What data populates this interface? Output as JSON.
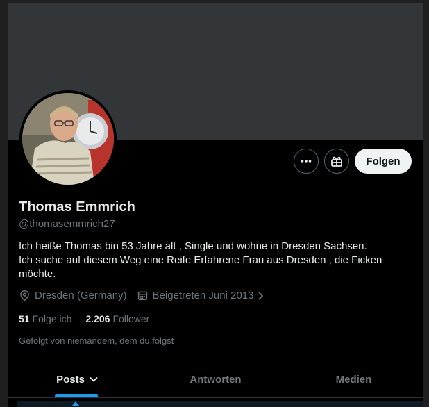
{
  "profile": {
    "name": "Thomas Emmrich",
    "handle": "@thomasemmrich27",
    "bio_lines": [
      "Ich heiße Thomas bin 53 Jahre alt , Single und wohne in Dresden Sachsen.",
      "Ich suche auf diesem Weg eine Reife Erfahrene Frau aus Dresden , die Ficken",
      "möchte."
    ],
    "location": "Dresden (Germany)",
    "joined": "Beigetreten Juni 2013"
  },
  "actions": {
    "more_icon": "more-dots-icon",
    "subscribe_icon": "gift-icon",
    "follow_label": "Folgen"
  },
  "stats": {
    "following_count": "51",
    "following_label": "Folge ich",
    "followers_count": "2.206",
    "followers_label": "Follower"
  },
  "followed_by": "Gefolgt von niemandem, dem du folgst",
  "tabs": [
    {
      "label": "Posts",
      "active": true
    },
    {
      "label": "Antworten",
      "active": false
    },
    {
      "label": "Medien",
      "active": false
    }
  ],
  "colors": {
    "accent": "#1d9bf0",
    "banner": "#333639",
    "background": "#000000",
    "muted_text": "#71767b"
  }
}
